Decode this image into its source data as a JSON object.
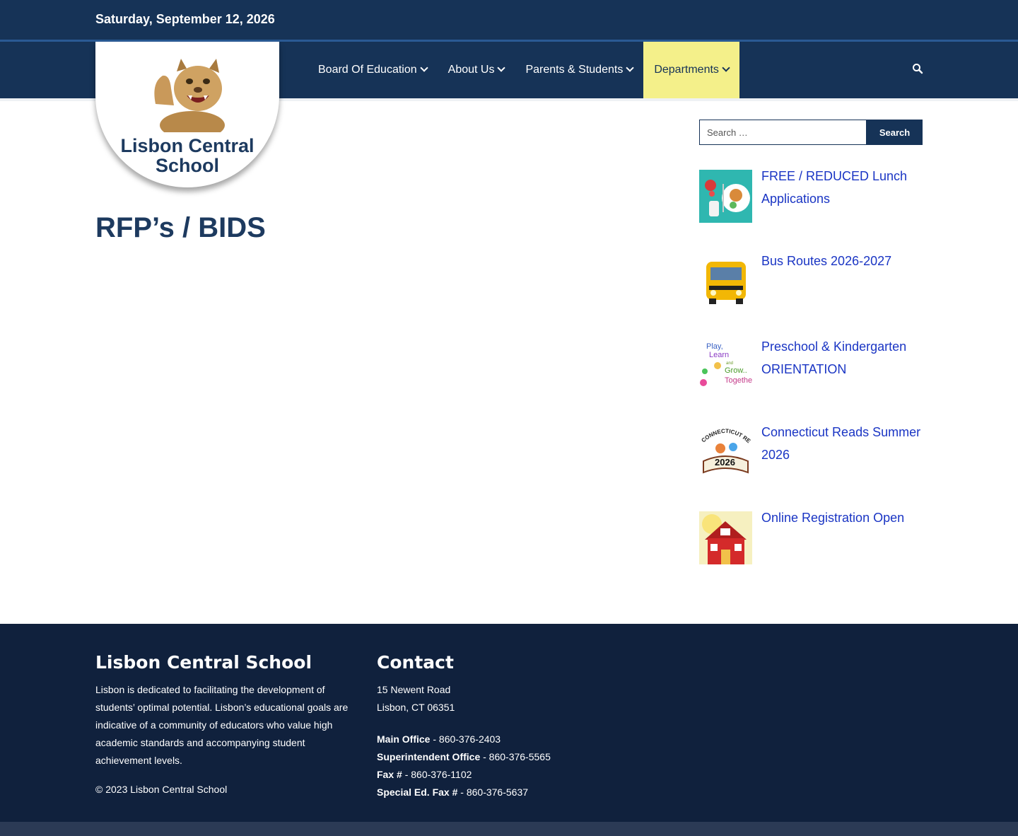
{
  "topbar": {
    "date": "Saturday, September 12, 2026"
  },
  "site": {
    "name": "Lisbon Central School"
  },
  "nav": {
    "items": [
      {
        "label": "Board Of Education"
      },
      {
        "label": "About Us"
      },
      {
        "label": "Parents & Students"
      },
      {
        "label": "Departments",
        "active": true
      }
    ]
  },
  "page": {
    "title": "RFP’s / BIDS"
  },
  "sidebar": {
    "search": {
      "placeholder": "Search …",
      "button_label": "Search"
    },
    "posts": [
      {
        "title": "FREE / REDUCED Lunch Applications"
      },
      {
        "title": "Bus Routes 2026-2027"
      },
      {
        "title": "Preschool & Kindergarten ORIENTATION"
      },
      {
        "title": "Connecticut Reads Summer 2026"
      },
      {
        "title": "Online Registration Open"
      }
    ],
    "thumb_text": {
      "play_learn": "Play, Learn and Grow.. Together",
      "reads_year": "2026",
      "reads_banner": "CONNECTICUT READS"
    }
  },
  "footer": {
    "about": {
      "heading": "Lisbon Central School",
      "text": "Lisbon is dedicated to facilitating the development of students’ optimal potential. Lisbon’s educational goals are indicative of a community of educators who value high academic standards and accompanying student achievement levels.",
      "copyright": "© 2023 Lisbon Central School"
    },
    "contact": {
      "heading": "Contact",
      "address1": "15 Newent Road",
      "address2": "Lisbon, CT 06351",
      "lines": [
        {
          "label": "Main Office",
          "value": " - 860-376-2403"
        },
        {
          "label": "Superintendent Office",
          "value": " - 860-376-5565"
        },
        {
          "label": "Fax #",
          "value": " - 860-376-1102"
        },
        {
          "label": "Special Ed. Fax #",
          "value": " - 860-376-5637"
        }
      ]
    }
  },
  "colors": {
    "navy": "#163357",
    "accent_yellow": "#f4f08a",
    "link_blue": "#1a35c4",
    "footer_bg": "#10213d"
  },
  "icons": {
    "search": "search-icon",
    "chevron": "chevron-down-icon",
    "mascot": "cougar-mascot-icon"
  }
}
